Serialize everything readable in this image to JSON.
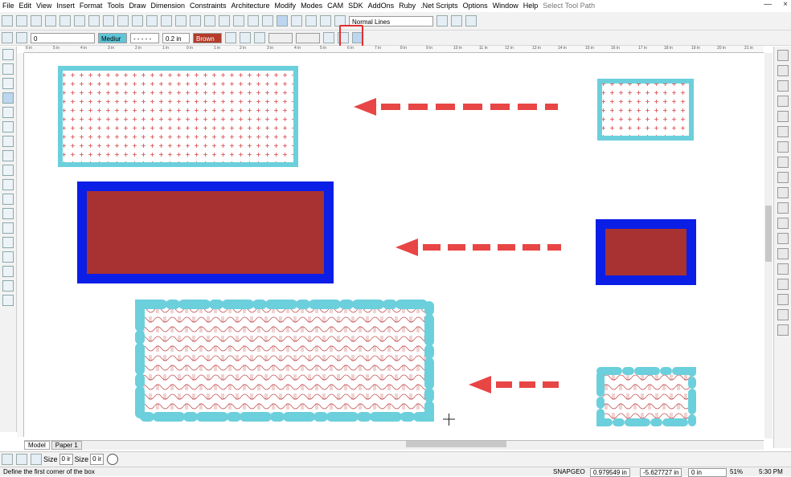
{
  "menu": {
    "items": [
      "File",
      "Edit",
      "View",
      "Insert",
      "Format",
      "Tools",
      "Draw",
      "Dimension",
      "Constraints",
      "Architecture",
      "Modify",
      "Modes",
      "CAM",
      "SDK",
      "AddOns",
      "Ruby",
      ".Net Scripts",
      "Options",
      "Window",
      "Help"
    ],
    "hint": "Select Tool Path"
  },
  "toolbar": {
    "line_style": "Normal Lines",
    "layer": "0",
    "line_weight": "Mediur",
    "dash_style": "- - - - -",
    "offset": "0.2 in",
    "color": "Brown"
  },
  "ruler": {
    "labels": [
      "6 in",
      "5 in",
      "4 in",
      "3 in",
      "2 in",
      "1 in",
      "0 in",
      "1 in",
      "2 in",
      "3 in",
      "4 in",
      "5 in",
      "6 in",
      "7 in",
      "8 in",
      "9 in",
      "10 in",
      "11 in",
      "12 in",
      "13 in",
      "14 in",
      "15 in",
      "16 in",
      "17 in",
      "18 in",
      "19 in",
      "20 in",
      "21 in"
    ]
  },
  "tabs": {
    "model": "Model",
    "paper": "Paper 1"
  },
  "inspector": {
    "size_label": "Size",
    "size_x": "0 ir",
    "size2_label": "Size",
    "size_y": "0 ir"
  },
  "status": {
    "message": "Define the first corner of the box",
    "snap": "SNAP",
    "geo": "GEO",
    "x": "0.979549 in",
    "y": "-5.627727 in",
    "z": "0 in",
    "zoom": "51%",
    "time": "5:30 PM"
  },
  "colors": {
    "cyan_border": "#6ccfdc",
    "blue_border": "#0b1ee6",
    "fill_brown": "#a83232",
    "arrow_red": "#e84545",
    "hatch_red": "#d84a4a"
  }
}
